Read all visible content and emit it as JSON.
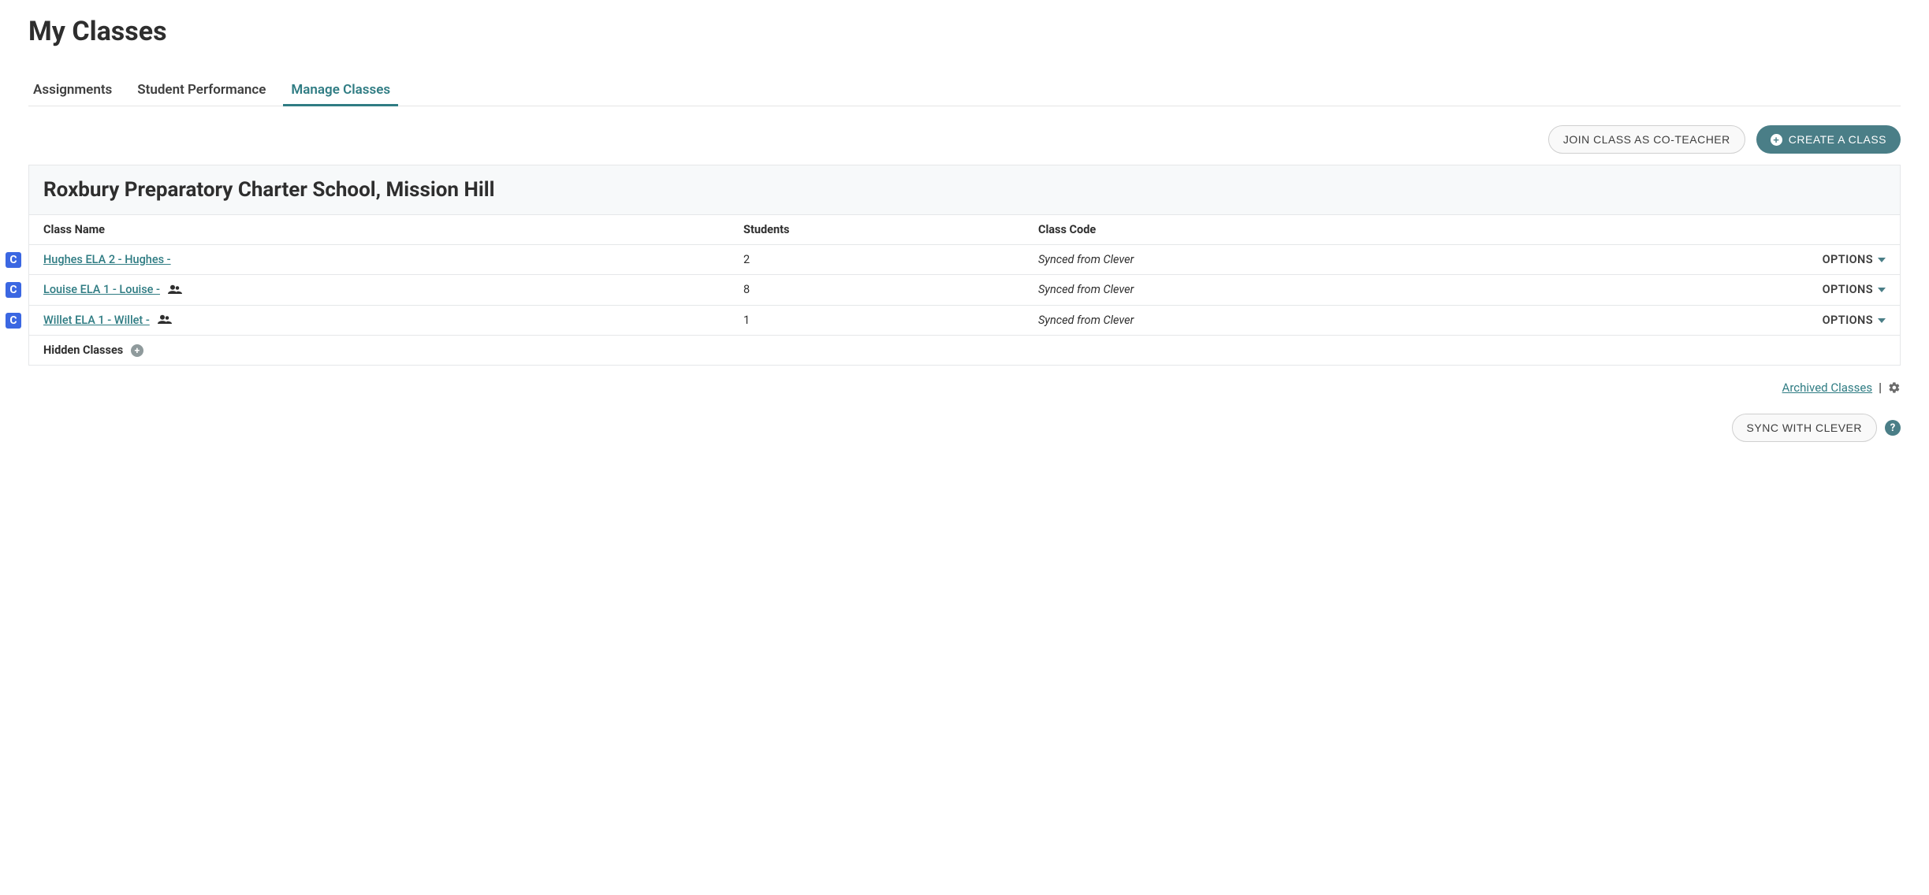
{
  "page_title": "My Classes",
  "tabs": {
    "assignments": "Assignments",
    "student_performance": "Student Performance",
    "manage_classes": "Manage Classes"
  },
  "active_tab": "Manage Classes",
  "buttons": {
    "join_co_teacher": "JOIN CLASS AS CO-TEACHER",
    "create_class": "CREATE A CLASS",
    "sync_with_clever": "SYNC WITH CLEVER"
  },
  "school_name": "Roxbury Preparatory Charter School, Mission Hill",
  "columns": {
    "class_name": "Class Name",
    "students": "Students",
    "class_code": "Class Code"
  },
  "options_label": "OPTIONS",
  "synced_text": "Synced from Clever",
  "clever_badge": "C",
  "classes": [
    {
      "name": "Hughes ELA 2 - Hughes -",
      "students": "2",
      "has_coteacher": false
    },
    {
      "name": "Louise ELA 1 - Louise -",
      "students": "8",
      "has_coteacher": true
    },
    {
      "name": "Willet ELA 1 - Willet -",
      "students": "1",
      "has_coteacher": true
    }
  ],
  "hidden_classes_label": "Hidden Classes",
  "archived_classes_label": "Archived Classes",
  "divider": "|",
  "help_char": "?"
}
